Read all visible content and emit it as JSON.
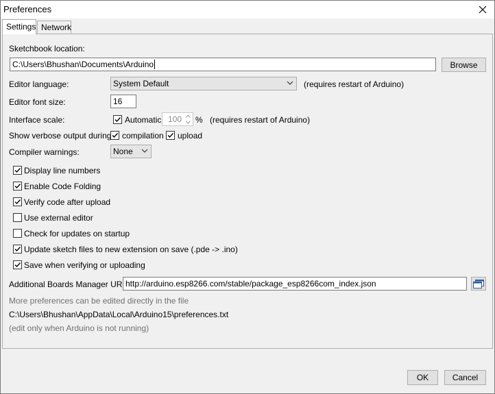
{
  "window": {
    "title": "Preferences"
  },
  "tabs": [
    {
      "label": "Settings",
      "active": true
    },
    {
      "label": "Network",
      "active": false
    }
  ],
  "sketchbook": {
    "label": "Sketchbook location:",
    "value": "C:\\Users\\Bhushan\\Documents\\Arduino",
    "browse_label": "Browse"
  },
  "editor_language": {
    "label": "Editor language:",
    "value": "System Default",
    "note": "(requires restart of Arduino)"
  },
  "editor_font_size": {
    "label": "Editor font size:",
    "value": "16"
  },
  "interface_scale": {
    "label": "Interface scale:",
    "automatic_label": "Automatic",
    "automatic_checked": true,
    "value": "100",
    "unit": "%",
    "note": "(requires restart of Arduino)"
  },
  "verbose": {
    "label": "Show verbose output during:",
    "compilation_label": "compilation",
    "compilation_checked": true,
    "upload_label": "upload",
    "upload_checked": true
  },
  "compiler_warnings": {
    "label": "Compiler warnings:",
    "value": "None"
  },
  "options": [
    {
      "label": "Display line numbers",
      "checked": true
    },
    {
      "label": "Enable Code Folding",
      "checked": true
    },
    {
      "label": "Verify code after upload",
      "checked": true
    },
    {
      "label": "Use external editor",
      "checked": false
    },
    {
      "label": "Check for updates on startup",
      "checked": false
    },
    {
      "label": "Update sketch files to new extension on save (.pde -> .ino)",
      "checked": true
    },
    {
      "label": "Save when verifying or uploading",
      "checked": true
    }
  ],
  "boards_manager": {
    "label": "Additional Boards Manager URLs:",
    "value": "http://arduino.esp8266.com/stable/package_esp8266com_index.json"
  },
  "footer_notes": {
    "more_prefs": "More preferences can be edited directly in the file",
    "path": "C:\\Users\\Bhushan\\AppData\\Local\\Arduino15\\preferences.txt",
    "edit_note": "(edit only when Arduino is not running)"
  },
  "buttons": {
    "ok": "OK",
    "cancel": "Cancel"
  }
}
